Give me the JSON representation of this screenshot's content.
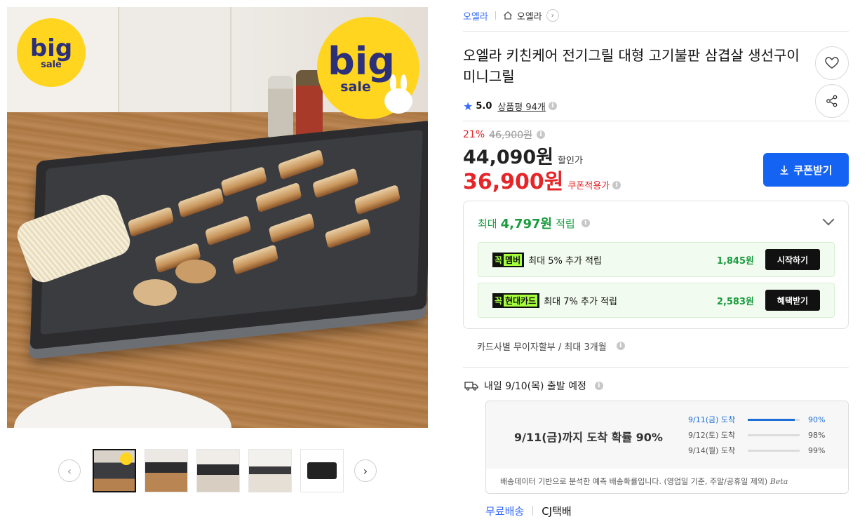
{
  "image": {
    "badge_big": "big",
    "badge_sale": "sale"
  },
  "breadcrumb": {
    "brand": "오엘라",
    "home_label": "오엘라"
  },
  "product": {
    "title": "오엘라 키친케어 전기그릴 대형 고기불판 삼겹살 생선구이 미니그릴",
    "rating_score": "5.0",
    "review_label": "상품평 94개",
    "discount_pct": "21%",
    "original_price": "46,900원",
    "sale_price": "44,090원",
    "sale_tag": "할인가",
    "coupon_price": "36,900원",
    "coupon_tag": "쿠폰적용가",
    "coupon_button": "쿠폰받기"
  },
  "rewards": {
    "head_prefix": "최대",
    "head_amount": "4,797원",
    "head_suffix": "적립",
    "rows": [
      {
        "logo_left": "꼭",
        "logo_right": "멤버",
        "text": "최대 5% 추가 적립",
        "amount": "1,845원",
        "action": "시작하기"
      },
      {
        "logo_left": "꼭",
        "logo_right": "현대카드",
        "text": "최대 7% 추가 적립",
        "amount": "2,583원",
        "action": "혜택받기"
      }
    ]
  },
  "installment": "카드사별 무이자할부 / 최대 3개월",
  "shipping": {
    "departure": "내일 9/10(목) 출발 예정",
    "headline": "9/11(금)까지 도착 확률 90%",
    "probabilities": [
      {
        "date": "9/11(금) 도착",
        "pct": "90%",
        "value": 90
      },
      {
        "date": "9/12(토) 도착",
        "pct": "98%",
        "value": 98
      },
      {
        "date": "9/14(월) 도착",
        "pct": "99%",
        "value": 99
      }
    ],
    "note": "배송데이터 기반으로 분석한 예측 배송확률입니다. (영업일 기준, 주말/공휴일 제외)",
    "beta": "Beta",
    "free_label": "무료배송",
    "carrier": "CJ택배"
  },
  "colors": {
    "accent_blue": "#1463f3",
    "price_red": "#e52528",
    "reward_green": "#1a9c3e"
  }
}
